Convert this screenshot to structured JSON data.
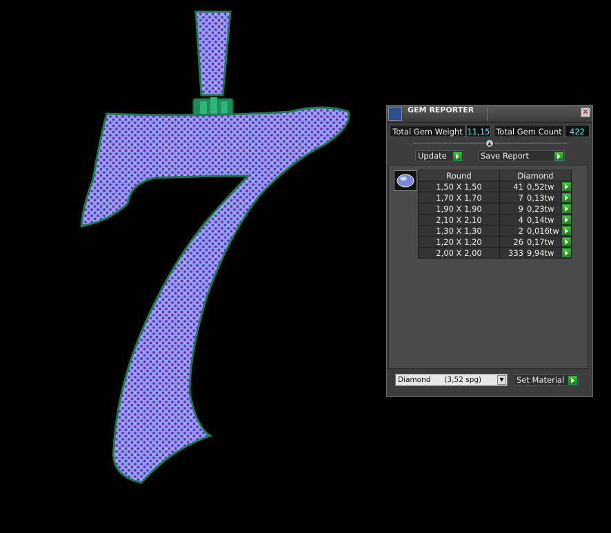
{
  "panel": {
    "title": "GEM REPORTER",
    "close_glyph": "✕",
    "total_weight_label": "Total Gem Weight",
    "total_weight_value": "11,15",
    "total_count_label": "Total Gem Count",
    "total_count_value": "422",
    "update_label": "Update",
    "save_report_label": "Save Report",
    "table": {
      "col_shape": "Round",
      "col_material": "Diamond",
      "rows": [
        {
          "size": "1,50 X 1,50",
          "count": "41",
          "weight": "0,52tw"
        },
        {
          "size": "1,70 X 1,70",
          "count": "7",
          "weight": "0,13tw"
        },
        {
          "size": "1,90 X 1,90",
          "count": "9",
          "weight": "0,23tw"
        },
        {
          "size": "2,10 X 2,10",
          "count": "4",
          "weight": "0,14tw"
        },
        {
          "size": "1,30 X 1,30",
          "count": "2",
          "weight": "0,016tw"
        },
        {
          "size": "1,20 X 1,20",
          "count": "26",
          "weight": "0,17tw"
        },
        {
          "size": "2,00 X 2,00",
          "count": "333",
          "weight": "9,94tw"
        }
      ]
    },
    "material_select_value": "Diamond      (3,52 spg)",
    "set_material_label": "Set Material"
  },
  "colors": {
    "gem_fill": "#8f9cf6",
    "gem_dot": "#6a2aa8",
    "metal": "#1e7a52",
    "accent_green": "#2fa820",
    "value_text": "#55eeee"
  }
}
